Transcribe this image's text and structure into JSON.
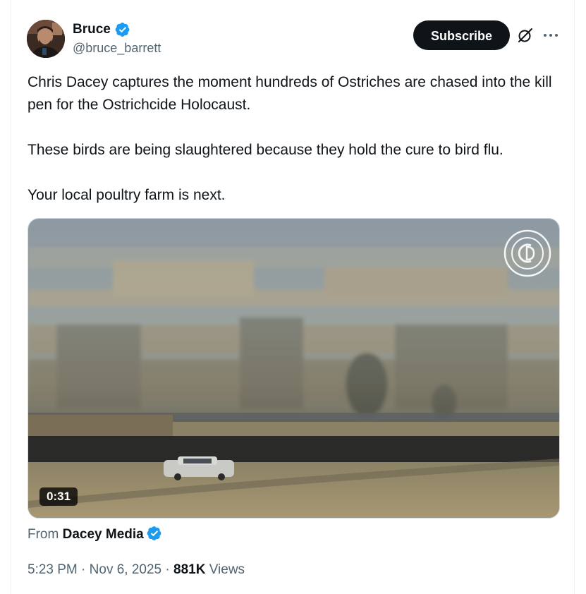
{
  "author": {
    "name": "Bruce",
    "handle": "@bruce_barrett",
    "verified": true,
    "verified_color": "#1d9bf0"
  },
  "actions": {
    "subscribe_label": "Subscribe",
    "grok_icon": "grok-icon",
    "more_icon": "more-icon"
  },
  "tweet": {
    "paragraphs": [
      "Chris Dacey captures the moment hundreds of Ostriches are chased into the kill pen for the Ostrichcide Holocaust.",
      "These birds are being slaughtered because they hold the cure to bird flu.",
      "Your local poultry farm is next."
    ]
  },
  "video": {
    "duration": "0:31",
    "watermark_icon": "dacey-media-watermark"
  },
  "source": {
    "prefix": "From",
    "name": "Dacey Media",
    "verified": true
  },
  "meta": {
    "time": "5:23 PM",
    "separator": "·",
    "date": "Nov 6, 2025",
    "views_count": "881K",
    "views_label": "Views"
  },
  "colors": {
    "text_primary": "#0f1419",
    "text_secondary": "#536471",
    "verified_blue": "#1d9bf0",
    "button_bg": "#0f1419",
    "border": "#cfd9de"
  }
}
